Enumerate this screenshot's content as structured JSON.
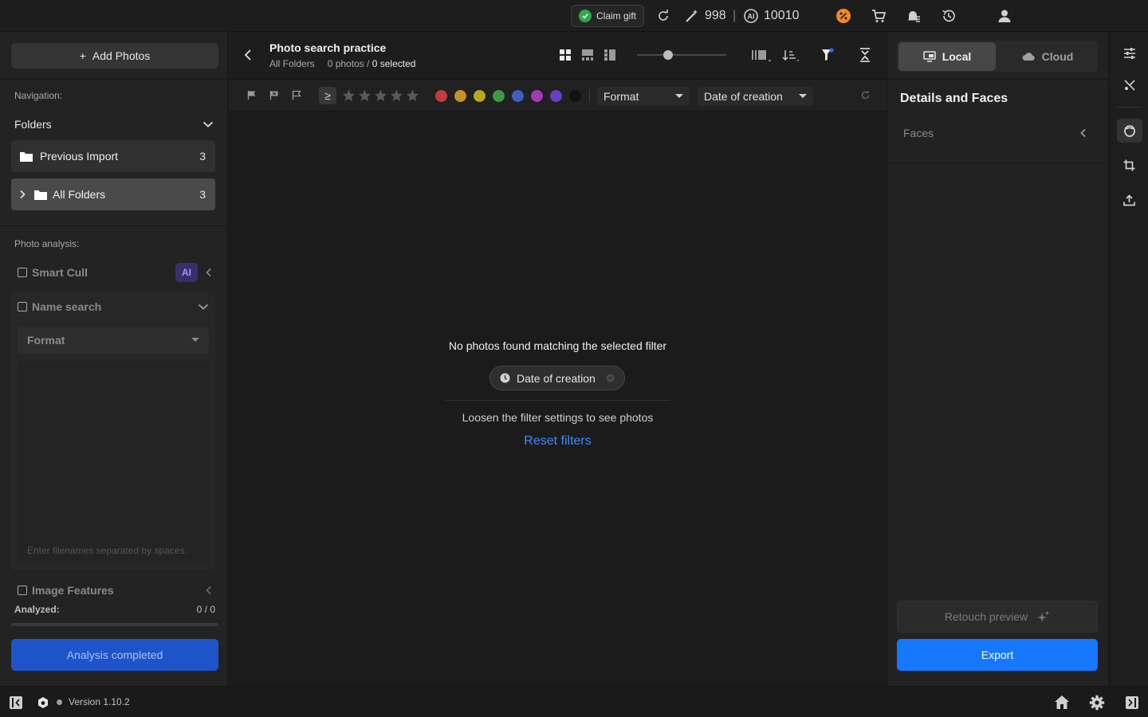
{
  "topbar": {
    "claim_gift": "Claim gift",
    "credits_count": "998",
    "separator": "|",
    "ai_credits": "10010"
  },
  "left": {
    "add_photos": "Add Photos",
    "navigation_label": "Navigation:",
    "folders_label": "Folders",
    "folders": [
      {
        "name": "Previous Import",
        "count": "3"
      },
      {
        "name": "All Folders",
        "count": "3"
      }
    ],
    "analysis_label": "Photo analysis:",
    "smart_cull": "Smart Cull",
    "ai_badge": "AI",
    "name_search": "Name search",
    "format_label": "Format",
    "filenames_placeholder": "Enter filenames separated by spaces.",
    "image_features": "Image Features",
    "analyzed_label": "Analyzed:",
    "analyzed_value": "0 / 0",
    "analyzed_progress": 0,
    "analysis_button": "Analysis completed"
  },
  "center": {
    "title": "Photo search practice",
    "breadcrumb": "All Folders",
    "photos_count": "0 photos /",
    "selected": "0 selected",
    "ge_symbol": "≥",
    "rating_stars": 5,
    "color_labels": [
      "#c63c3c",
      "#c8902a",
      "#b6a91f",
      "#3e9a42",
      "#3f5fc0",
      "#a33bb8",
      "#6a3ec0",
      "#111111"
    ],
    "format_dropdown": "Format",
    "date_dropdown": "Date of creation",
    "thumb_size": 0.35,
    "empty_title": "No photos found matching the selected filter",
    "filter_chip": "Date of creation",
    "empty_hint": "Loosen the filter settings to see photos",
    "reset_filters": "Reset filters"
  },
  "right": {
    "local_tab": "Local",
    "cloud_tab": "Cloud",
    "section_title": "Details and Faces",
    "faces_label": "Faces",
    "retouch_preview": "Retouch preview",
    "export": "Export"
  },
  "bottom": {
    "version": "Version 1.10.2"
  },
  "colors": {
    "accent_blue": "#1677ff",
    "analysis_button": "#1d54c9",
    "link_blue": "#3d8bff",
    "green_check": "#2faa4b",
    "orange_badge": "#f08a24"
  }
}
